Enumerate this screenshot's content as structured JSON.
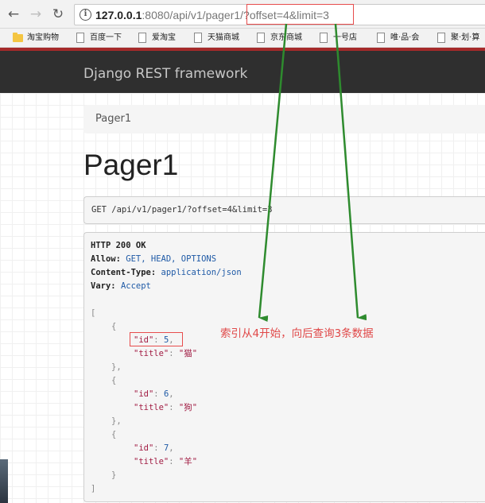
{
  "browser": {
    "url_host": "127.0.0.1",
    "url_rest": ":8080/api/v1/pager1/",
    "url_query": "?offset=4&limit=3",
    "bookmarks": [
      {
        "label": "淘宝购物",
        "type": "folder"
      },
      {
        "label": "百度一下",
        "type": "page"
      },
      {
        "label": "爱淘宝",
        "type": "page"
      },
      {
        "label": "天猫商城",
        "type": "page"
      },
      {
        "label": "京东商城",
        "type": "page"
      },
      {
        "label": "一号店",
        "type": "page"
      },
      {
        "label": "唯·品·会",
        "type": "page"
      },
      {
        "label": "聚·划·算",
        "type": "page"
      }
    ]
  },
  "navbar": {
    "brand": "Django REST framework"
  },
  "breadcrumb": {
    "label": "Pager1"
  },
  "page": {
    "title": "Pager1"
  },
  "request": {
    "line": "GET /api/v1/pager1/?offset=4&limit=3"
  },
  "response": {
    "status": "HTTP 200 OK",
    "headers": [
      {
        "key": "Allow:",
        "value": "GET, HEAD, OPTIONS"
      },
      {
        "key": "Content-Type:",
        "value": "application/json"
      },
      {
        "key": "Vary:",
        "value": "Accept"
      }
    ],
    "items": [
      {
        "id_key": "\"id\"",
        "id": "5",
        "title_key": "\"title\"",
        "title": "\"猫\""
      },
      {
        "id_key": "\"id\"",
        "id": "6",
        "title_key": "\"title\"",
        "title": "\"狗\""
      },
      {
        "id_key": "\"id\"",
        "id": "7",
        "title_key": "\"title\"",
        "title": "\"羊\""
      }
    ]
  },
  "annotation": {
    "text": "索引从4开始，向后查询3条数据",
    "color": "#e04848"
  },
  "colors": {
    "arrow": "#2e8b2e",
    "highlight": "#e74c4c"
  }
}
